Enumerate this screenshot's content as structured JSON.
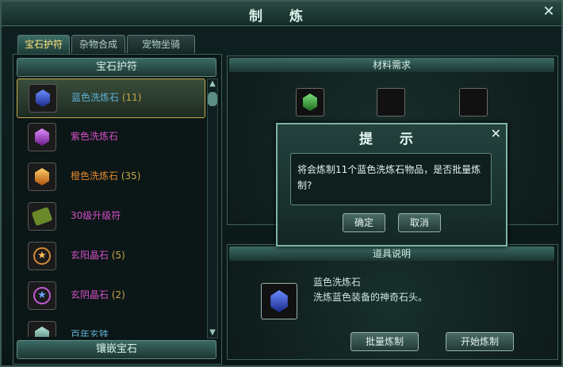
{
  "window": {
    "title": "制 炼",
    "close": "✕"
  },
  "tabs": [
    {
      "label": "宝石护符"
    },
    {
      "label": "杂物合成"
    },
    {
      "label": "宠物坐骑"
    }
  ],
  "left": {
    "header": "宝石护符",
    "footer": "镶嵌宝石",
    "items": [
      {
        "name": "蓝色洗炼石",
        "count": "(11)",
        "icon": "blue-gem-icon",
        "color": "#5fb2d6"
      },
      {
        "name": "紫色洗炼石",
        "count": "",
        "icon": "purple-gem-icon",
        "color": "#d64fc9"
      },
      {
        "name": "橙色洗炼石",
        "count": "(35)",
        "icon": "orange-gem-icon",
        "color": "#e2892e"
      },
      {
        "name": "30级升级符",
        "count": "",
        "icon": "scroll-icon",
        "color": "#d64fc9"
      },
      {
        "name": "玄阳晶石",
        "count": "(5)",
        "icon": "sun-crystal-icon",
        "color": "#d64fc9"
      },
      {
        "name": "玄阴晶石",
        "count": "(2)",
        "icon": "moon-crystal-icon",
        "color": "#d64fc9"
      },
      {
        "name": "百年玄铁",
        "count": "",
        "icon": "iron-icon",
        "color": "#5fb2d6"
      }
    ]
  },
  "materials": {
    "header": "材料需求"
  },
  "description": {
    "header": "道具说明",
    "item_name": "蓝色洗炼石",
    "item_desc": "洗炼蓝色装备的神奇石头。"
  },
  "buttons": {
    "batch": "批量炼制",
    "start": "开始炼制"
  },
  "dialog": {
    "title": "提 示",
    "close": "✕",
    "message": "将会炼制11个蓝色洗炼石物品，是否批量炼制?",
    "confirm": "确定",
    "cancel": "取消"
  }
}
